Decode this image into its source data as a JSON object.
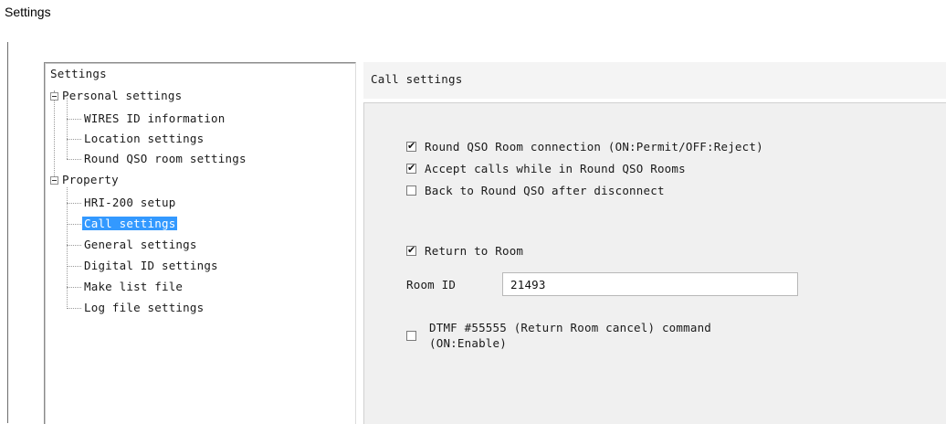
{
  "window": {
    "title": "Settings"
  },
  "tree": {
    "root": "Settings",
    "groups": [
      {
        "label": "Personal settings",
        "items": [
          "WIRES ID information",
          "Location settings",
          "Round QSO room settings"
        ]
      },
      {
        "label": "Property",
        "items": [
          "HRI-200 setup",
          "Call settings",
          "General settings",
          "Digital ID settings",
          "Make list file",
          "Log file settings"
        ]
      }
    ],
    "selected": "Call settings"
  },
  "panel": {
    "title": "Call settings",
    "round_qso_connection": {
      "label": "Round QSO Room connection (ON:Permit/OFF:Reject)",
      "checked": true
    },
    "accept_calls": {
      "label": "Accept calls while in Round QSO Rooms",
      "checked": true
    },
    "back_to_round_qso": {
      "label": "Back to Round QSO after disconnect",
      "checked": false
    },
    "return_to_room": {
      "label": "Return to Room",
      "checked": true
    },
    "room_id": {
      "label": "Room ID",
      "value": "21493"
    },
    "dtmf": {
      "line1": "DTMF #55555 (Return Room cancel) command",
      "line2": "(ON:Enable)",
      "checked": false
    }
  }
}
